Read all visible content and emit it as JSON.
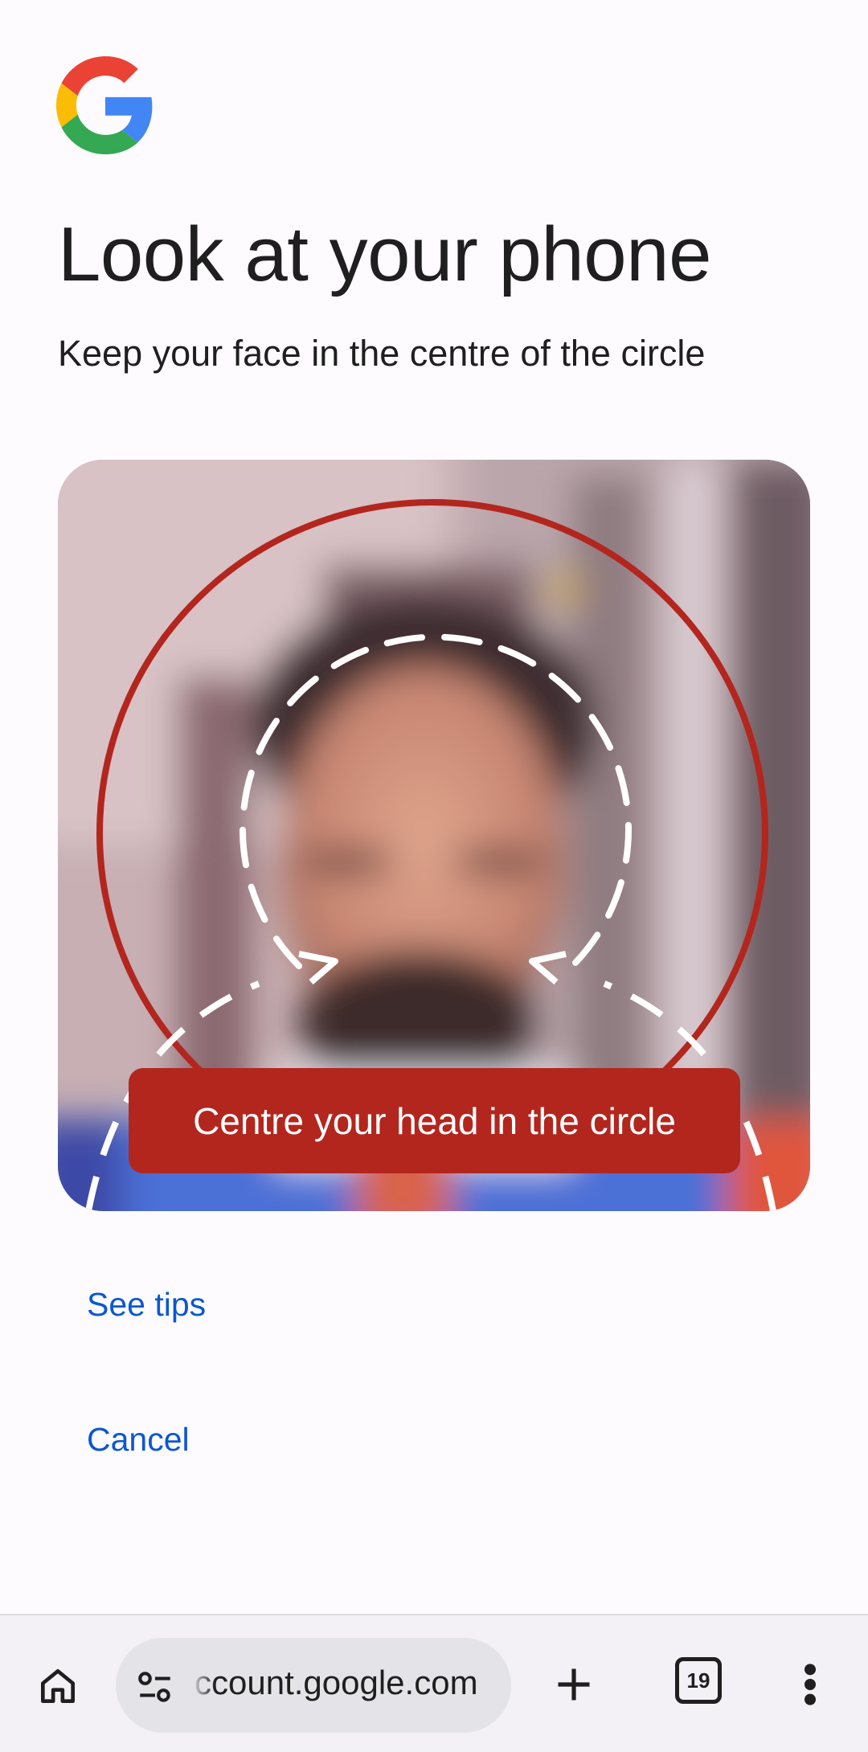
{
  "header": {
    "logo_icon": "google-g-icon",
    "title": "Look at your phone",
    "subtitle": "Keep your face in the centre of the circle"
  },
  "camera": {
    "guide_banner": "Centre your head in the circle",
    "banner_color": "#b3261e",
    "ring_color": "#b3261e"
  },
  "actions": {
    "see_tips": "See tips",
    "cancel": "Cancel"
  },
  "browser_bar": {
    "home_icon": "home-icon",
    "site_settings_icon": "tune-icon",
    "url": "ccount.google.com",
    "new_tab_icon": "plus-icon",
    "tab_count": "19",
    "menu_icon": "more-vert-icon"
  },
  "colors": {
    "link": "#0b57d0",
    "text": "#1f1f1f",
    "background": "#fefbff"
  }
}
